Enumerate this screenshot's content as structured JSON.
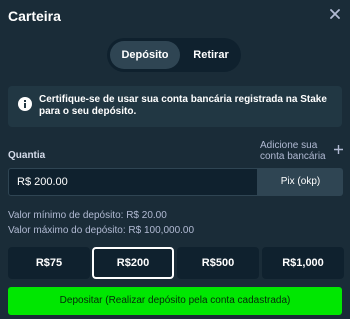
{
  "header": {
    "title": "Carteira",
    "close_icon": "close-icon"
  },
  "tabs": [
    {
      "label": "Depósito",
      "active": true
    },
    {
      "label": "Retirar",
      "active": false
    }
  ],
  "notice": {
    "icon": "info-icon",
    "text": "Certifique-se de usar sua conta bancária registrada na Stake para o seu depósito."
  },
  "form": {
    "amount_label": "Quantia",
    "add_account_label": "Adicione sua conta bancária",
    "amount_value": "R$ 200.00",
    "method_label": "Pix (okp)",
    "min_text": "Valor mínimo de depósito: R$ 20.00",
    "max_text": "Valor máximo do depósito: R$ 100,000.00"
  },
  "amounts": [
    {
      "label": "R$75",
      "selected": false
    },
    {
      "label": "R$200",
      "selected": true
    },
    {
      "label": "R$500",
      "selected": false
    },
    {
      "label": "R$1,000",
      "selected": false
    }
  ],
  "submit": {
    "label": "Depositar (Realizar depósito pela conta cadastrada)"
  },
  "colors": {
    "background": "#1a2c38",
    "panel": "#213743",
    "input": "#0f212e",
    "accent_green": "#00e701"
  }
}
